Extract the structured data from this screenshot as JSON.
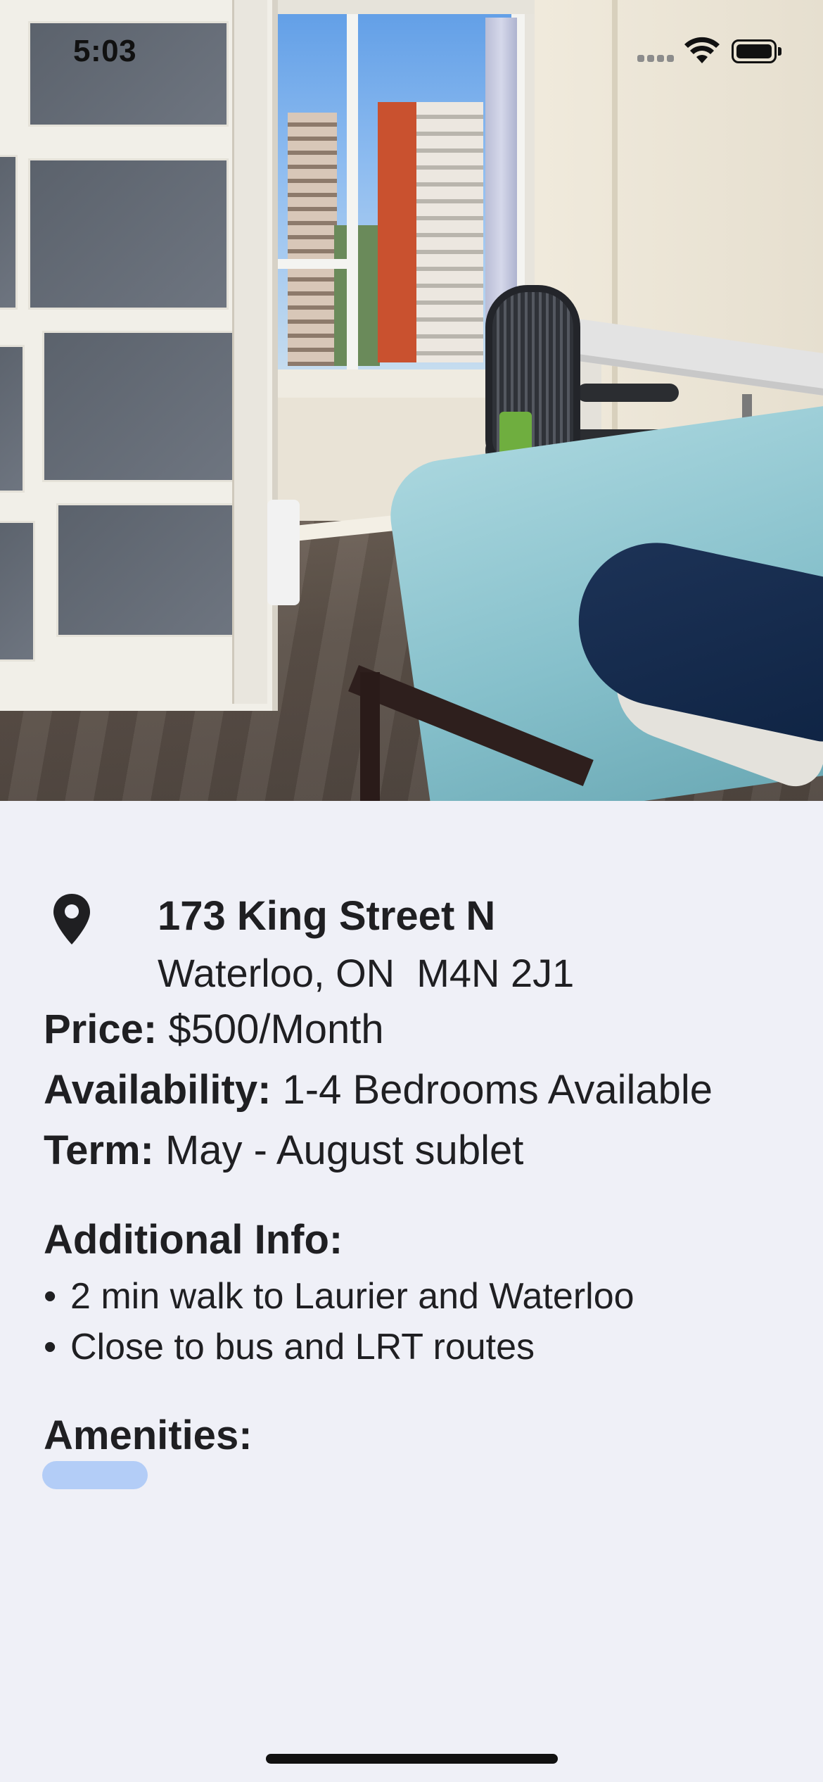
{
  "status_bar": {
    "time": "5:03",
    "icons": [
      "cellular-signal-icon",
      "wifi-icon",
      "battery-icon"
    ]
  },
  "hero": {
    "image_description_icon": "room-photo"
  },
  "listing": {
    "address": {
      "icon": "map-pin-icon",
      "street": "173 King Street N",
      "city_line": "Waterloo, ON  M4N 2J1"
    },
    "facts": [
      {
        "label": "Price:",
        "value": " $500/Month"
      },
      {
        "label": "Availability:",
        "value": " 1-4 Bedrooms Available"
      },
      {
        "label": "Term:",
        "value": " May - August sublet"
      }
    ],
    "additional_info": {
      "title": "Additional Info:",
      "items": [
        {
          "bullet": "•",
          "text": "2 min walk to Laurier and Waterloo"
        },
        {
          "bullet": "•",
          "text": "Close to bus and LRT routes"
        }
      ]
    },
    "amenities": {
      "title": "Amenities:",
      "chip_color": "#b3cdf7"
    }
  },
  "colors": {
    "background": "#eff0f7",
    "text": "#1f1f22"
  }
}
